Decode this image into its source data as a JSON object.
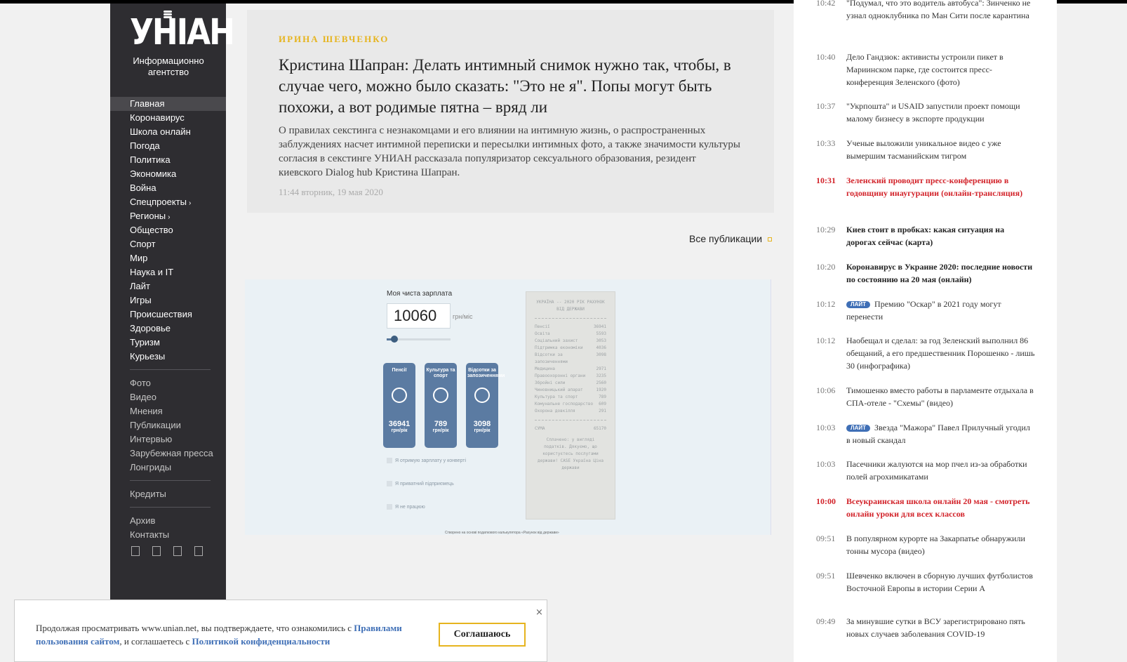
{
  "logo": {
    "mark": "УНІАН",
    "subtitle": "Информационно агентство"
  },
  "nav": {
    "primary": [
      "Главная",
      "Коронавирус",
      "Школа онлайн",
      "Погода",
      "Политика",
      "Экономика",
      "Война",
      "Спецпроекты",
      "Регионы",
      "Общество",
      "Спорт",
      "Мир",
      "Наука и IT",
      "Лайт",
      "Игры",
      "Происшествия",
      "Здоровье",
      "Туризм",
      "Курьезы"
    ],
    "arrow": "›",
    "secondary": [
      "Фото",
      "Видео",
      "Мнения",
      "Публикации",
      "Интервью",
      "Зарубежная пресса",
      "Лонгриды"
    ],
    "tertiary": [
      "Кредиты"
    ],
    "quaternary": [
      "Архив",
      "Контакты"
    ]
  },
  "article": {
    "author": "ИРИНА ШЕВЧЕНКО",
    "headline": "Кристина Шапран: Делать интимный снимок нужно так, чтобы, в случае чего, можно было сказать: \"Это не я\". Попы могут быть похожи, а вот родимые пятна – вряд ли",
    "lead": "О правилах секстинга с незнакомцами и его влиянии на интимную жизнь, о распространенных заблуждениях насчет интимной переписки и пересылки интимных фото, а также значимости культуры согласия в секстинге УНИАН рассказала популяризатор сексуального образования, резидент киевского Dialog hub Кристина Шапран.",
    "date": "11:44 вторник, 19 мая 2020"
  },
  "all_publications": "Все публикации",
  "embed": {
    "title": "Моя чиста зарплата",
    "salary": "10060",
    "unit": "грн/міс",
    "slider_fraction": 0.12,
    "tiles": [
      {
        "label": "Пенсії",
        "value": "36941",
        "unit": "грн/рік"
      },
      {
        "label": "Культура та спорт",
        "value": "789",
        "unit": "грн/рік"
      },
      {
        "label": "Відсотки за запозиченнями",
        "value": "3098",
        "unit": "грн/рік"
      }
    ],
    "checks": [
      "Я отримую зарплату у конверті",
      "Я приватний підприємець",
      "Я не працюю"
    ],
    "receipt": {
      "head": "УКРАЇНА -- 2020 РІК РАХУНОК ВІД ДЕРЖАВИ",
      "rows": [
        {
          "k": "Пенсії",
          "v": "36941"
        },
        {
          "k": "Освіта",
          "v": "5593"
        },
        {
          "k": "Соціальний захист",
          "v": "3053"
        },
        {
          "k": "Підтримка економіки",
          "v": "4036"
        },
        {
          "k": "Відсотки за запозиченнями",
          "v": "3098"
        },
        {
          "k": "Медицина",
          "v": "2971"
        },
        {
          "k": "Правоохоронні органи",
          "v": "3235"
        },
        {
          "k": "Збройні сили",
          "v": "2560"
        },
        {
          "k": "Чиновницький апарат",
          "v": "1920"
        },
        {
          "k": "Культура та спорт",
          "v": "789"
        },
        {
          "k": "Комунальне господарство",
          "v": "609"
        },
        {
          "k": "Охорона довкілля",
          "v": "291"
        }
      ],
      "total_label": "СУМА",
      "total": "65170",
      "foot": "Сплачено: у вигляді податків. Дякуємо, що користуєтесь послугами держави! CASE Україна Ціна держави"
    },
    "credit": "Створено на основі податкового калькулятора «Рахунок від держави»"
  },
  "feed": [
    {
      "time": "10:42",
      "text": "\"Подумал, что это водитель автобуса\": Зинченко не узнал одноклубника по Ман Сити после карантина",
      "style": "normal"
    },
    {
      "time": "10:40",
      "text": "Дело Гандзюк: активисты устроили пикет в Мариинском парке, где состоится пресс-конференция Зеленского (фото)",
      "style": "normal"
    },
    {
      "time": "10:37",
      "text": "\"Укрпошта\" и USAID запустили проект помощи малому бизнесу в экспорте продукции",
      "style": "normal"
    },
    {
      "time": "10:33",
      "text": "Ученые выложили уникальное видео с уже вымершим тасманийским тигром",
      "style": "normal"
    },
    {
      "time": "10:31",
      "text": "Зеленский проводит пресс-конференцию в годовщину инаугурации (онлайн-трансляция)",
      "style": "red"
    },
    {
      "time": "10:29",
      "text": "Киев стоит в пробках: какая ситуация на дорогах сейчас (карта)",
      "style": "bold"
    },
    {
      "time": "10:20",
      "text": "Коронавирус в Украине 2020: последние новости по состоянию на 20 мая (онлайн)",
      "style": "bold"
    },
    {
      "time": "10:12",
      "badge": "ЛАЙТ",
      "text": "Премию \"Оскар\" в 2021 году могут перенести",
      "style": "normal"
    },
    {
      "time": "10:12",
      "text": "Наобещал и сделал: за год Зеленский выполнил 86 обещаний, а его предшественник Порошенко - лишь 30 (инфографика)",
      "style": "normal"
    },
    {
      "time": "10:06",
      "text": "Тимошенко вместо работы в парламенте отдыхала в СПА-отеле - \"Схемы\" (видео)",
      "style": "normal"
    },
    {
      "time": "10:03",
      "badge": "ЛАЙТ",
      "text": "Звезда \"Мажора\" Павел Прилучный угодил в новый скандал",
      "style": "normal"
    },
    {
      "time": "10:03",
      "text": "Пасечники жалуются на мор пчел из-за обработки полей агрохимикатами",
      "style": "normal"
    },
    {
      "time": "10:00",
      "text": "Всеукраинская школа онлайн 20 мая - смотреть онлайн уроки для всех классов",
      "style": "red"
    },
    {
      "time": "09:51",
      "text": "В популярном курорте на Закарпатье обнаружили тонны мусора (видео)",
      "style": "normal"
    },
    {
      "time": "09:51",
      "text": "Шевченко включен в сборную лучших футболистов Восточной Европы в истории Серии А",
      "style": "normal"
    },
    {
      "time": "09:49",
      "text": "За минувшие сутки в ВСУ зарегистрировано пять новых случаев заболевания COVID-19",
      "style": "normal"
    }
  ],
  "cookie": {
    "text_1": "Продолжая просматривать www.unian.net, вы подтверждаете, что ознакомились с ",
    "link_1": "Правилами пользования сайтом",
    "text_2": ", и соглашаетесь с ",
    "link_2": "Политикой конфиденциальности",
    "button": "Соглашаюсь",
    "close": "×"
  },
  "colors": {
    "accent": "#e6b41e",
    "link": "#3f6fb6",
    "breaking": "#d2232a",
    "sidebar": "#2e2d31"
  }
}
